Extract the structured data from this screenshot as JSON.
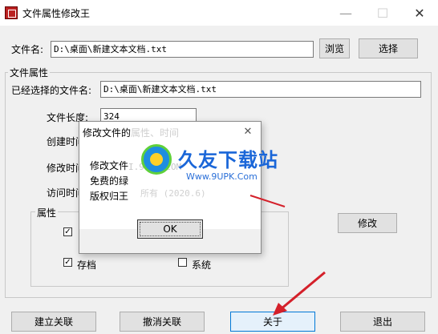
{
  "window": {
    "title": "文件属性修改王",
    "minimize_glyph": "—",
    "maximize_glyph": "☐",
    "close_glyph": "✕"
  },
  "top": {
    "file_label": "文件名:",
    "file_value": "D:\\桌面\\新建文本文档.txt",
    "browse_label": "浏览",
    "select_label": "选择"
  },
  "props": {
    "group_label": "文件属性",
    "selected_label": "已经选择的文件名:",
    "selected_value": "D:\\桌面\\新建文本文档.txt",
    "length_label": "文件长度:",
    "length_value": "324",
    "created_label": "创建时间",
    "modified_label": "修改时间",
    "accessed_label": "访问时间",
    "modify_button": "修改"
  },
  "attrs": {
    "group_label": "属性",
    "archive_label": "存档",
    "system_label": "系统",
    "archive_checked": true,
    "system_checked": false,
    "readonly_checked": true,
    "check_glyph": "✓"
  },
  "bottom": {
    "create_assoc": "建立关联",
    "cancel_assoc": "撤消关联",
    "about": "关于",
    "exit": "退出"
  },
  "dialog": {
    "title": "修改文件的",
    "title_faint": "属性、时间",
    "line1": "修改文件",
    "line2": "免费的绿",
    "line3": "版权归王",
    "ok": "OK"
  },
  "watermark": {
    "brand": "久友下载站",
    "url": "Www.9UPK.Com",
    "faint1": "I.9UPK.COM",
    "faint2": "所有 (2020.6)"
  },
  "colors": {
    "arrow": "#d4202a",
    "watermark_blue": "#1a66d8"
  }
}
